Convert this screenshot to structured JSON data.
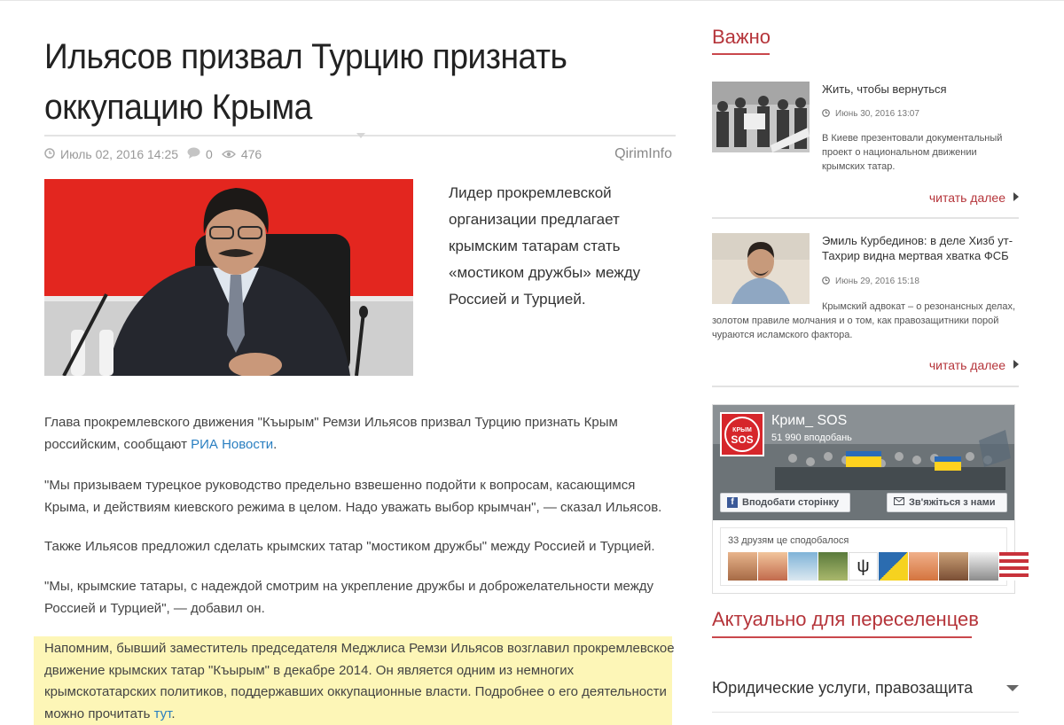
{
  "article": {
    "title": "Ильясов призвал Турцию признать оккупацию Крыма",
    "date": "Июль 02, 2016 14:25",
    "comments": "0",
    "views": "476",
    "source": "QirimInfo",
    "lead": "Лидер прокремлевской организации предлагает крымским татарам стать «мостиком дружбы» между Россией и Турцией.",
    "p1_text": "Глава прокремлевского движения \"Къырым\" Ремзи Ильясов призвал Турцию признать Крым российским, сообщают ",
    "p1_link": "РИА Новости",
    "p1_end": ".",
    "p2": "\"Мы призываем турецкое руководство предельно взвешенно подойти к вопросам, касающимся Крыма, и действиям киевского режима в целом. Надо уважать выбор крымчан\", — сказал Ильясов.",
    "p3": "Также Ильясов предложил сделать крымских татар \"мостиком дружбы\" между Россией и Турцией.",
    "p4": "\"Мы, крымские татары, с надеждой смотрим на укрепление дружбы и доброжелательности между Россией и Турцией\", — добавил он.",
    "p5_text": "Напомним, бывший заместитель председателя Меджлиса Ремзи Ильясов возглавил прокремлевское движение крымских татар \"Къырым\" в декабре 2014. Он является одним из немногих крымскотатарских политиков, поддержавших оккупационные власти. Подробнее о его деятельности можно прочитать ",
    "p5_link": "тут",
    "p5_end": "."
  },
  "sidebar": {
    "important_title": "Важно",
    "news": [
      {
        "title": "Жить, чтобы вернуться",
        "date": "Июнь 30, 2016 13:07",
        "desc": "В Киеве презентовали документальный проект о национальном движении крымских татар.",
        "more": "читать далее"
      },
      {
        "title": "Эмиль Курбединов: в деле Хизб ут-Тахрир видна мертвая хватка ФСБ",
        "date": "Июнь 29, 2016 15:18",
        "desc": "Крымский адвокат – о резонансных делах, золотом правиле молчания и о том, как правозащитники порой чураются исламского фактора.",
        "more": "читать далее"
      }
    ],
    "facebook": {
      "logo_top": "КРЫМ",
      "logo_bottom": "SOS",
      "page_name": "Крим_ SOS",
      "likes": "51 990 вподобань",
      "like_button": "Вподобати сторінку",
      "contact_button": "Зв'яжіться з нами",
      "friends_text": "33 друзям це сподобалося"
    },
    "resettlers_title": "Актуально для переселенцев",
    "accordion_item": "Юридические услуги, правозащита"
  },
  "colors": {
    "accent": "#b5343a",
    "link": "#2a7fc1",
    "highlight": "#fdf6b7"
  }
}
